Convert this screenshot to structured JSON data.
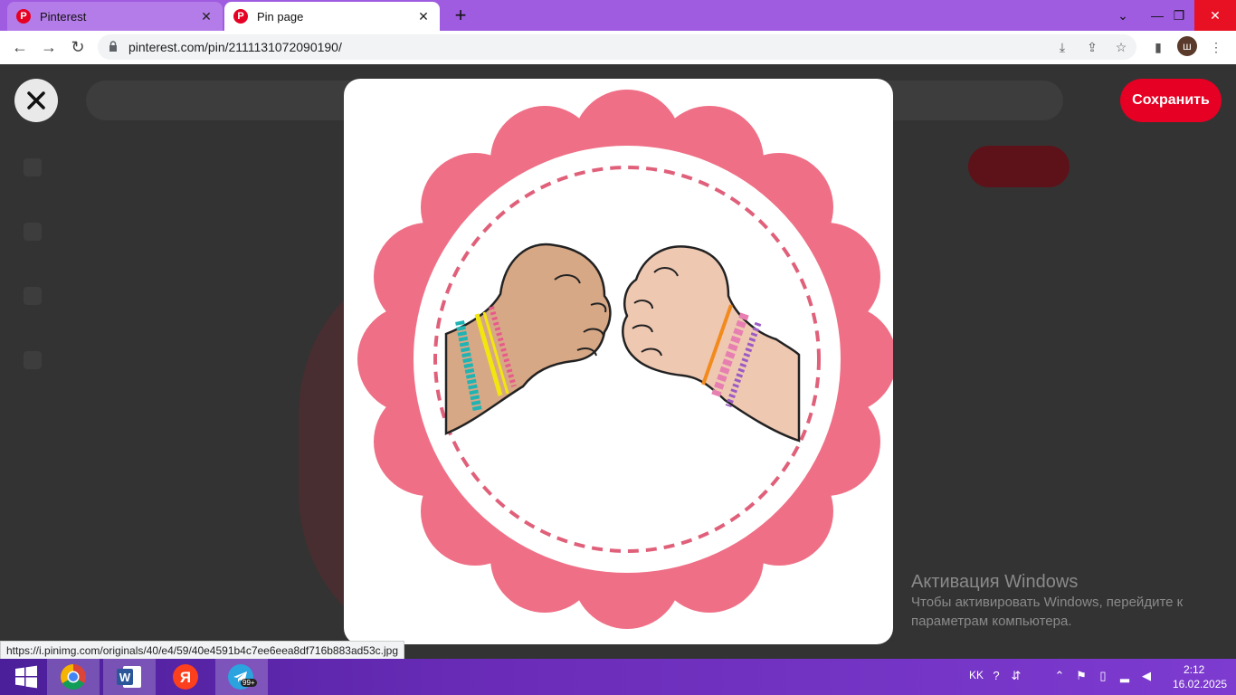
{
  "browser": {
    "tabs": [
      {
        "title": "Pinterest",
        "active": false
      },
      {
        "title": "Pin page",
        "active": true
      }
    ],
    "url": "pinterest.com/pin/2111131072090190/",
    "profile_initial": "ш"
  },
  "page": {
    "save_label": "Сохранить",
    "status_url": "https://i.pinimg.com/originals/40/e4/59/40e4591b4c7ee6eea8df716b883ad53c.jpg"
  },
  "watermark": {
    "title": "Активация Windows",
    "line1": "Чтобы активировать Windows, перейдите к",
    "line2": "параметрам компьютера."
  },
  "taskbar": {
    "apps": [
      "start-icon",
      "chrome-icon",
      "word-icon",
      "yandex-icon",
      "telegram-icon"
    ],
    "telegram_badge": "99+",
    "lang": "KK",
    "time": "2:12",
    "date": "16.02.2025"
  },
  "colors": {
    "tab_bar": "#a05ce0",
    "pinterest_red": "#e60023",
    "scallop_pink": "#ef6f86"
  }
}
